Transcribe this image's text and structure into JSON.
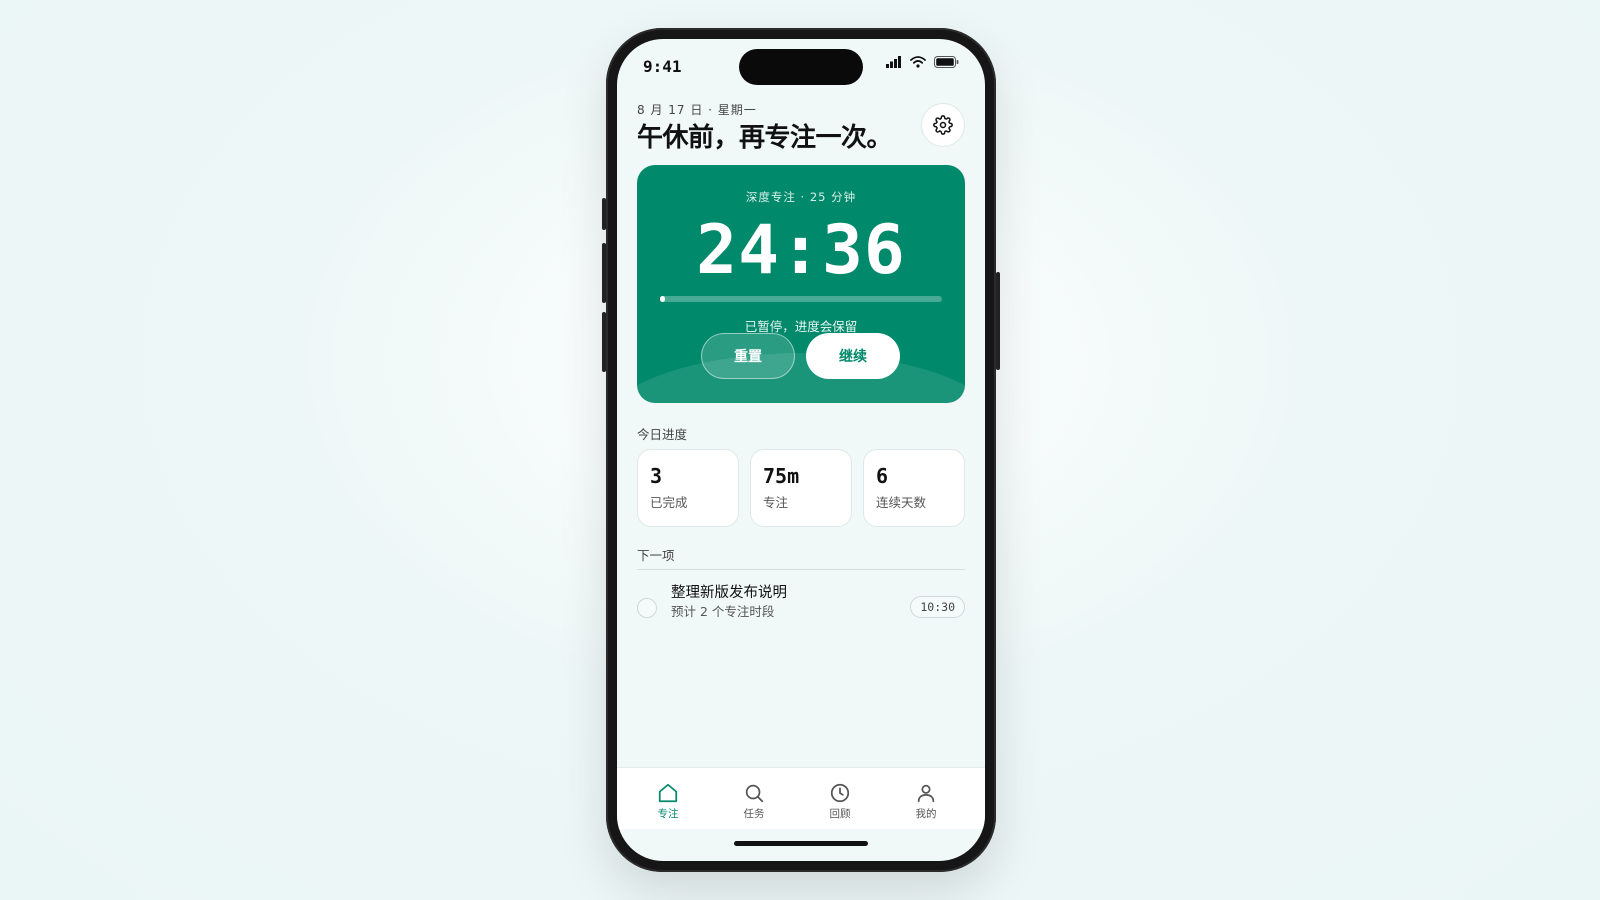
{
  "status": {
    "time": "9:41"
  },
  "header": {
    "date": "8 月 17 日 · 星期一",
    "title": "午休前，再专注一次。"
  },
  "timer": {
    "subtitle": "深度专注 · 25 分钟",
    "time": "24:36",
    "progress": 0.016,
    "status": "已暂停，进度会保留",
    "reset_label": "重置",
    "resume_label": "继续"
  },
  "today": {
    "label": "今日进度",
    "stats": [
      {
        "value": "3",
        "label": "已完成"
      },
      {
        "value": "75m",
        "label": "专注"
      },
      {
        "value": "6",
        "label": "连续天数"
      }
    ]
  },
  "next": {
    "label": "下一项",
    "task": {
      "title": "整理新版发布说明",
      "subtitle": "预计 2 个专注时段",
      "time": "10:30"
    }
  },
  "tabs": [
    {
      "label": "专注",
      "icon": "home-icon",
      "active": true
    },
    {
      "label": "任务",
      "icon": "search-icon",
      "active": false
    },
    {
      "label": "回顾",
      "icon": "clock-icon",
      "active": false
    },
    {
      "label": "我的",
      "icon": "user-icon",
      "active": false
    }
  ],
  "colors": {
    "accent": "#00896b",
    "background": "#f1f8f8"
  }
}
